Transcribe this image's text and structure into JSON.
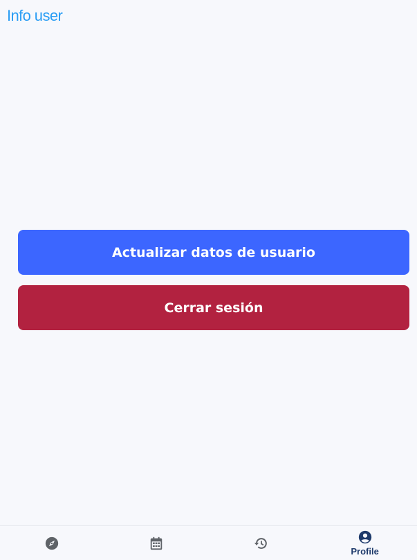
{
  "header": {
    "title": "Info user"
  },
  "actions": {
    "update_label": "Actualizar datos de usuario",
    "logout_label": "Cerrar sesión"
  },
  "colors": {
    "title": "#2a9df4",
    "update_button": "#3c66ff",
    "logout_button": "#b22240",
    "nav_icon": "#5f6368",
    "nav_active": "#1e3a6b"
  },
  "bottom_nav": {
    "items": [
      {
        "icon": "compass-icon",
        "label": ""
      },
      {
        "icon": "calendar-icon",
        "label": ""
      },
      {
        "icon": "history-icon",
        "label": ""
      },
      {
        "icon": "account-circle-icon",
        "label": "Profile",
        "active": true
      }
    ]
  }
}
